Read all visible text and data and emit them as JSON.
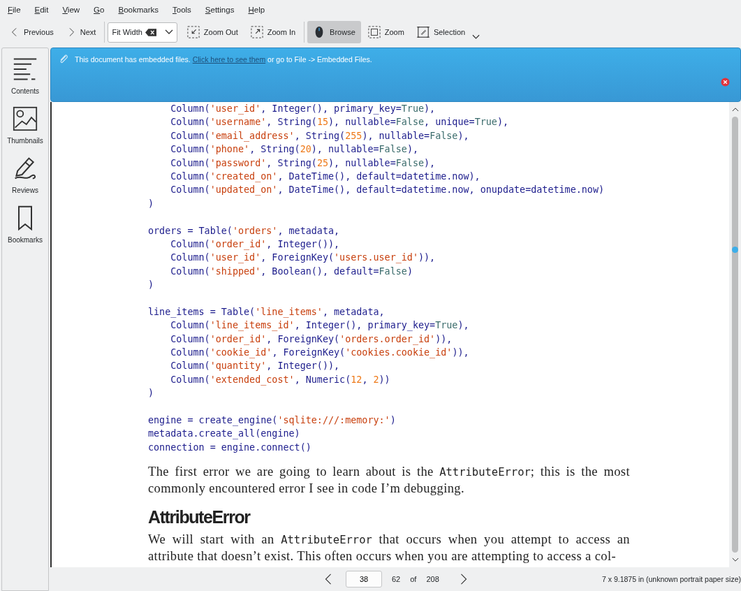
{
  "menu": [
    {
      "label": "File"
    },
    {
      "label": "Edit"
    },
    {
      "label": "View"
    },
    {
      "label": "Go"
    },
    {
      "label": "Bookmarks"
    },
    {
      "label": "Tools"
    },
    {
      "label": "Settings"
    },
    {
      "label": "Help"
    }
  ],
  "toolbar": {
    "nav": [
      {
        "label": "Previous"
      },
      {
        "label": "Next"
      }
    ],
    "zoom_combo": {
      "value": "Fit Width"
    },
    "zoom_buttons": [
      {
        "label": "Zoom Out"
      },
      {
        "label": "Zoom In"
      }
    ],
    "modes": [
      {
        "label": "Browse",
        "selected": true
      },
      {
        "label": "Zoom",
        "selected": false
      },
      {
        "label": "Selection",
        "selected": false
      }
    ]
  },
  "sidebar": {
    "items": [
      {
        "label": "Contents"
      },
      {
        "label": "Thumbnails"
      },
      {
        "label": "Reviews"
      },
      {
        "label": "Bookmarks"
      }
    ]
  },
  "banner": {
    "text_before": "This document has embedded files.",
    "link": "Click here to see them",
    "text_after": "or go to File -> Embedded Files."
  },
  "document": {
    "code_blocks": [
      {
        "lines": [
          [
            {
              "kind": "code",
              "text": "    Column("
            },
            {
              "kind": "str",
              "text": "'user_id'"
            },
            {
              "kind": "code",
              "text": ", Integer(), primary_key="
            },
            {
              "kind": "const",
              "text": "True"
            },
            {
              "kind": "code",
              "text": "),"
            }
          ],
          [
            {
              "kind": "code",
              "text": "    Column("
            },
            {
              "kind": "str",
              "text": "'username'"
            },
            {
              "kind": "code",
              "text": ", String("
            },
            {
              "kind": "num",
              "text": "15"
            },
            {
              "kind": "code",
              "text": "), nullable="
            },
            {
              "kind": "const",
              "text": "False"
            },
            {
              "kind": "code",
              "text": ", unique="
            },
            {
              "kind": "const",
              "text": "True"
            },
            {
              "kind": "code",
              "text": "),"
            }
          ],
          [
            {
              "kind": "code",
              "text": "    Column("
            },
            {
              "kind": "str",
              "text": "'email_address'"
            },
            {
              "kind": "code",
              "text": ", String("
            },
            {
              "kind": "num",
              "text": "255"
            },
            {
              "kind": "code",
              "text": "), nullable="
            },
            {
              "kind": "const",
              "text": "False"
            },
            {
              "kind": "code",
              "text": "),"
            }
          ],
          [
            {
              "kind": "code",
              "text": "    Column("
            },
            {
              "kind": "str",
              "text": "'phone'"
            },
            {
              "kind": "code",
              "text": ", String("
            },
            {
              "kind": "num",
              "text": "20"
            },
            {
              "kind": "code",
              "text": "), nullable="
            },
            {
              "kind": "const",
              "text": "False"
            },
            {
              "kind": "code",
              "text": "),"
            }
          ],
          [
            {
              "kind": "code",
              "text": "    Column("
            },
            {
              "kind": "str",
              "text": "'password'"
            },
            {
              "kind": "code",
              "text": ", String("
            },
            {
              "kind": "num",
              "text": "25"
            },
            {
              "kind": "code",
              "text": "), nullable="
            },
            {
              "kind": "const",
              "text": "False"
            },
            {
              "kind": "code",
              "text": "),"
            }
          ],
          [
            {
              "kind": "code",
              "text": "    Column("
            },
            {
              "kind": "str",
              "text": "'created_on'"
            },
            {
              "kind": "code",
              "text": ", DateTime(), default=datetime.now),"
            }
          ],
          [
            {
              "kind": "code",
              "text": "    Column("
            },
            {
              "kind": "str",
              "text": "'updated_on'"
            },
            {
              "kind": "code",
              "text": ", DateTime(), default=datetime.now, onupdate=datetime.now)"
            }
          ],
          [
            {
              "kind": "code",
              "text": ")"
            }
          ]
        ]
      },
      {
        "lines": [
          [
            {
              "kind": "code",
              "text": "orders = Table("
            },
            {
              "kind": "str",
              "text": "'orders'"
            },
            {
              "kind": "code",
              "text": ", metadata,"
            }
          ],
          [
            {
              "kind": "code",
              "text": "    Column("
            },
            {
              "kind": "str",
              "text": "'order_id'"
            },
            {
              "kind": "code",
              "text": ", Integer()),"
            }
          ],
          [
            {
              "kind": "code",
              "text": "    Column("
            },
            {
              "kind": "str",
              "text": "'user_id'"
            },
            {
              "kind": "code",
              "text": ", ForeignKey("
            },
            {
              "kind": "str",
              "text": "'users.user_id'"
            },
            {
              "kind": "code",
              "text": ")),"
            }
          ],
          [
            {
              "kind": "code",
              "text": "    Column("
            },
            {
              "kind": "str",
              "text": "'shipped'"
            },
            {
              "kind": "code",
              "text": ", Boolean(), default="
            },
            {
              "kind": "const",
              "text": "False"
            },
            {
              "kind": "code",
              "text": ")"
            }
          ],
          [
            {
              "kind": "code",
              "text": ")"
            }
          ]
        ]
      },
      {
        "lines": [
          [
            {
              "kind": "code",
              "text": "line_items = Table("
            },
            {
              "kind": "str",
              "text": "'line_items'"
            },
            {
              "kind": "code",
              "text": ", metadata,"
            }
          ],
          [
            {
              "kind": "code",
              "text": "    Column("
            },
            {
              "kind": "str",
              "text": "'line_items_id'"
            },
            {
              "kind": "code",
              "text": ", Integer(), primary_key="
            },
            {
              "kind": "const",
              "text": "True"
            },
            {
              "kind": "code",
              "text": "),"
            }
          ],
          [
            {
              "kind": "code",
              "text": "    Column("
            },
            {
              "kind": "str",
              "text": "'order_id'"
            },
            {
              "kind": "code",
              "text": ", ForeignKey("
            },
            {
              "kind": "str",
              "text": "'orders.order_id'"
            },
            {
              "kind": "code",
              "text": ")),"
            }
          ],
          [
            {
              "kind": "code",
              "text": "    Column("
            },
            {
              "kind": "str",
              "text": "'cookie_id'"
            },
            {
              "kind": "code",
              "text": ", ForeignKey("
            },
            {
              "kind": "str",
              "text": "'cookies.cookie_id'"
            },
            {
              "kind": "code",
              "text": ")),"
            }
          ],
          [
            {
              "kind": "code",
              "text": "    Column("
            },
            {
              "kind": "str",
              "text": "'quantity'"
            },
            {
              "kind": "code",
              "text": ", Integer()),"
            }
          ],
          [
            {
              "kind": "code",
              "text": "    Column("
            },
            {
              "kind": "str",
              "text": "'extended_cost'"
            },
            {
              "kind": "code",
              "text": ", Numeric("
            },
            {
              "kind": "num",
              "text": "12"
            },
            {
              "kind": "code",
              "text": ", "
            },
            {
              "kind": "num",
              "text": "2"
            },
            {
              "kind": "code",
              "text": "))"
            }
          ],
          [
            {
              "kind": "code",
              "text": ")"
            }
          ]
        ]
      },
      {
        "lines": [
          [
            {
              "kind": "code",
              "text": "engine = create_engine("
            },
            {
              "kind": "str",
              "text": "'sqlite:///:memory:'"
            },
            {
              "kind": "code",
              "text": ")"
            }
          ],
          [
            {
              "kind": "code",
              "text": "metadata.create_all(engine)"
            }
          ],
          [
            {
              "kind": "code",
              "text": "connection = engine.connect()"
            }
          ]
        ]
      }
    ],
    "after": [
      {
        "kind": "paragraph",
        "parts": [
          {
            "kind": "text",
            "text": "The first error we are going to learn about is the "
          },
          {
            "kind": "code",
            "text": "AttributeError"
          },
          {
            "kind": "text",
            "text": "; this is the most commonly encountered error I see in code I’m debugging."
          }
        ]
      },
      {
        "kind": "heading",
        "text": "AttributeError"
      },
      {
        "kind": "paragraph",
        "parts": [
          {
            "kind": "text",
            "text": "We will start with an "
          },
          {
            "kind": "code",
            "text": "AttributeError"
          },
          {
            "kind": "text",
            "text": " that occurs when you attempt to access an attribute that doesn’t exist. This often occurs when you are attempting to access a col-"
          }
        ]
      }
    ]
  },
  "status_bar": {
    "page_input": "38",
    "page_label": "62",
    "of": "of",
    "total": "208",
    "paper_size": "7 x 9.1875 in (unknown portrait paper size)"
  }
}
